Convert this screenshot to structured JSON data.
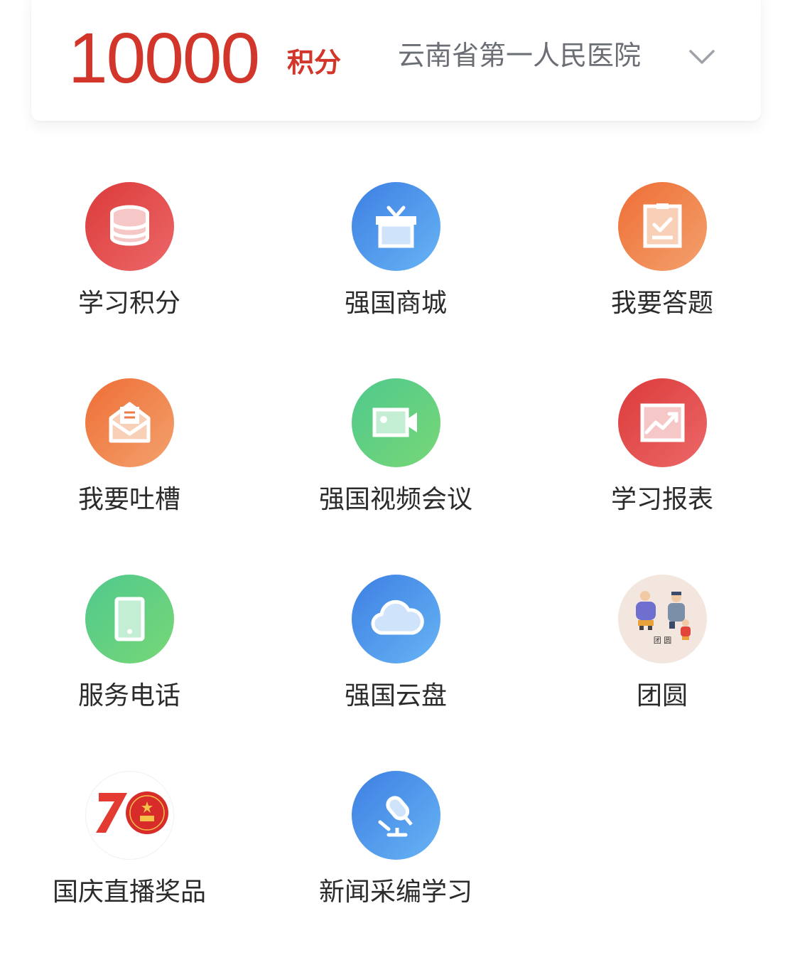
{
  "header": {
    "points_value": "10000",
    "points_unit": "积分",
    "organization": "云南省第一人民医院",
    "dropdown_icon": "chevron-down-icon"
  },
  "colors": {
    "accent_red": "#d2352a",
    "icon_red": "#e04444",
    "icon_blue": "#4b8ff0",
    "icon_orange": "#f0804a",
    "icon_green": "#5fcf85"
  },
  "menu": {
    "items": [
      {
        "label": "学习积分",
        "icon": "database-icon"
      },
      {
        "label": "强国商城",
        "icon": "gift-icon"
      },
      {
        "label": "我要答题",
        "icon": "clipboard-check-icon"
      },
      {
        "label": "我要吐槽",
        "icon": "mail-open-icon"
      },
      {
        "label": "强国视频会议",
        "icon": "video-camera-icon"
      },
      {
        "label": "学习报表",
        "icon": "chart-trend-icon"
      },
      {
        "label": "服务电话",
        "icon": "phone-icon"
      },
      {
        "label": "强国云盘",
        "icon": "cloud-icon"
      },
      {
        "label": "团圆",
        "icon": "reunion-illustration-icon",
        "badge": "团 圆"
      },
      {
        "label": "国庆直播奖品",
        "icon": "anniversary-70-logo",
        "badge": "70"
      },
      {
        "label": "新闻采编学习",
        "icon": "microphone-icon"
      }
    ]
  }
}
